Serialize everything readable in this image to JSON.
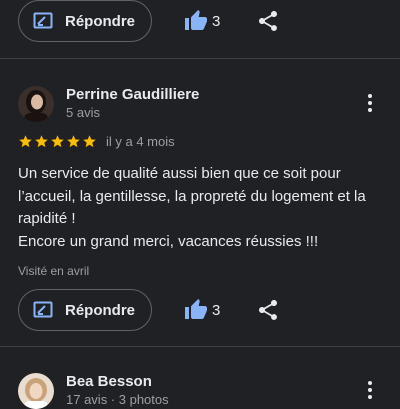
{
  "top_actions": {
    "reply_label": "Répondre",
    "like_count": "3"
  },
  "review_1": {
    "author": "Perrine Gaudilliere",
    "meta": "5 avis",
    "rating": 5,
    "date": "il y a 4 mois",
    "text_line_1": "Un service de qualité aussi bien que ce soit pour l’accueil, la gentillesse, la propreté du logement et la rapidité !",
    "text_line_2": "Encore un grand merci, vacances réussies !!!",
    "visited": "Visité en avril",
    "reply_label": "Répondre",
    "like_count": "3"
  },
  "review_2": {
    "author": "Bea Besson",
    "meta": "17 avis · 3 photos"
  },
  "colors": {
    "star": "#fbbc04",
    "accent": "#8ab4f8",
    "background": "#202124"
  },
  "icons": [
    "reply-icon",
    "thumb-up-icon",
    "share-icon",
    "more-vert-icon",
    "star-icon"
  ]
}
